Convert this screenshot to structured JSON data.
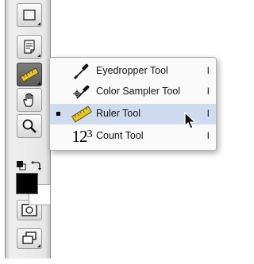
{
  "toolbox": {
    "tools": [
      {
        "name": "marquee-tool",
        "icon": "marquee-icon"
      },
      {
        "name": "notes-tool",
        "icon": "notes-icon"
      },
      {
        "name": "ruler-tool",
        "icon": "ruler-icon",
        "active": true
      },
      {
        "name": "hand-tool",
        "icon": "hand-icon"
      },
      {
        "name": "zoom-tool",
        "icon": "zoom-icon"
      }
    ],
    "foreground_color": "#000000",
    "background_color": "#ffffff",
    "bottom_tools": [
      {
        "name": "quick-mask-mode",
        "icon": "quick-mask-icon"
      },
      {
        "name": "screen-mode",
        "icon": "screen-mode-icon"
      }
    ]
  },
  "flyout": {
    "items": [
      {
        "label": "Eyedropper Tool",
        "shortcut": "I",
        "icon": "eyedropper-icon",
        "selected": false
      },
      {
        "label": "Color Sampler Tool",
        "shortcut": "I",
        "icon": "color-sampler-icon",
        "selected": false
      },
      {
        "label": "Ruler Tool",
        "shortcut": "I",
        "icon": "ruler-icon",
        "selected": true
      },
      {
        "label": "Count Tool",
        "shortcut": "I",
        "icon": "count-icon",
        "selected": false
      }
    ],
    "count_icon": {
      "digits": "12",
      "superscript": "3"
    }
  },
  "colors": {
    "selection": "#cfdcf0",
    "ruler_yellow": "#e8c832"
  }
}
